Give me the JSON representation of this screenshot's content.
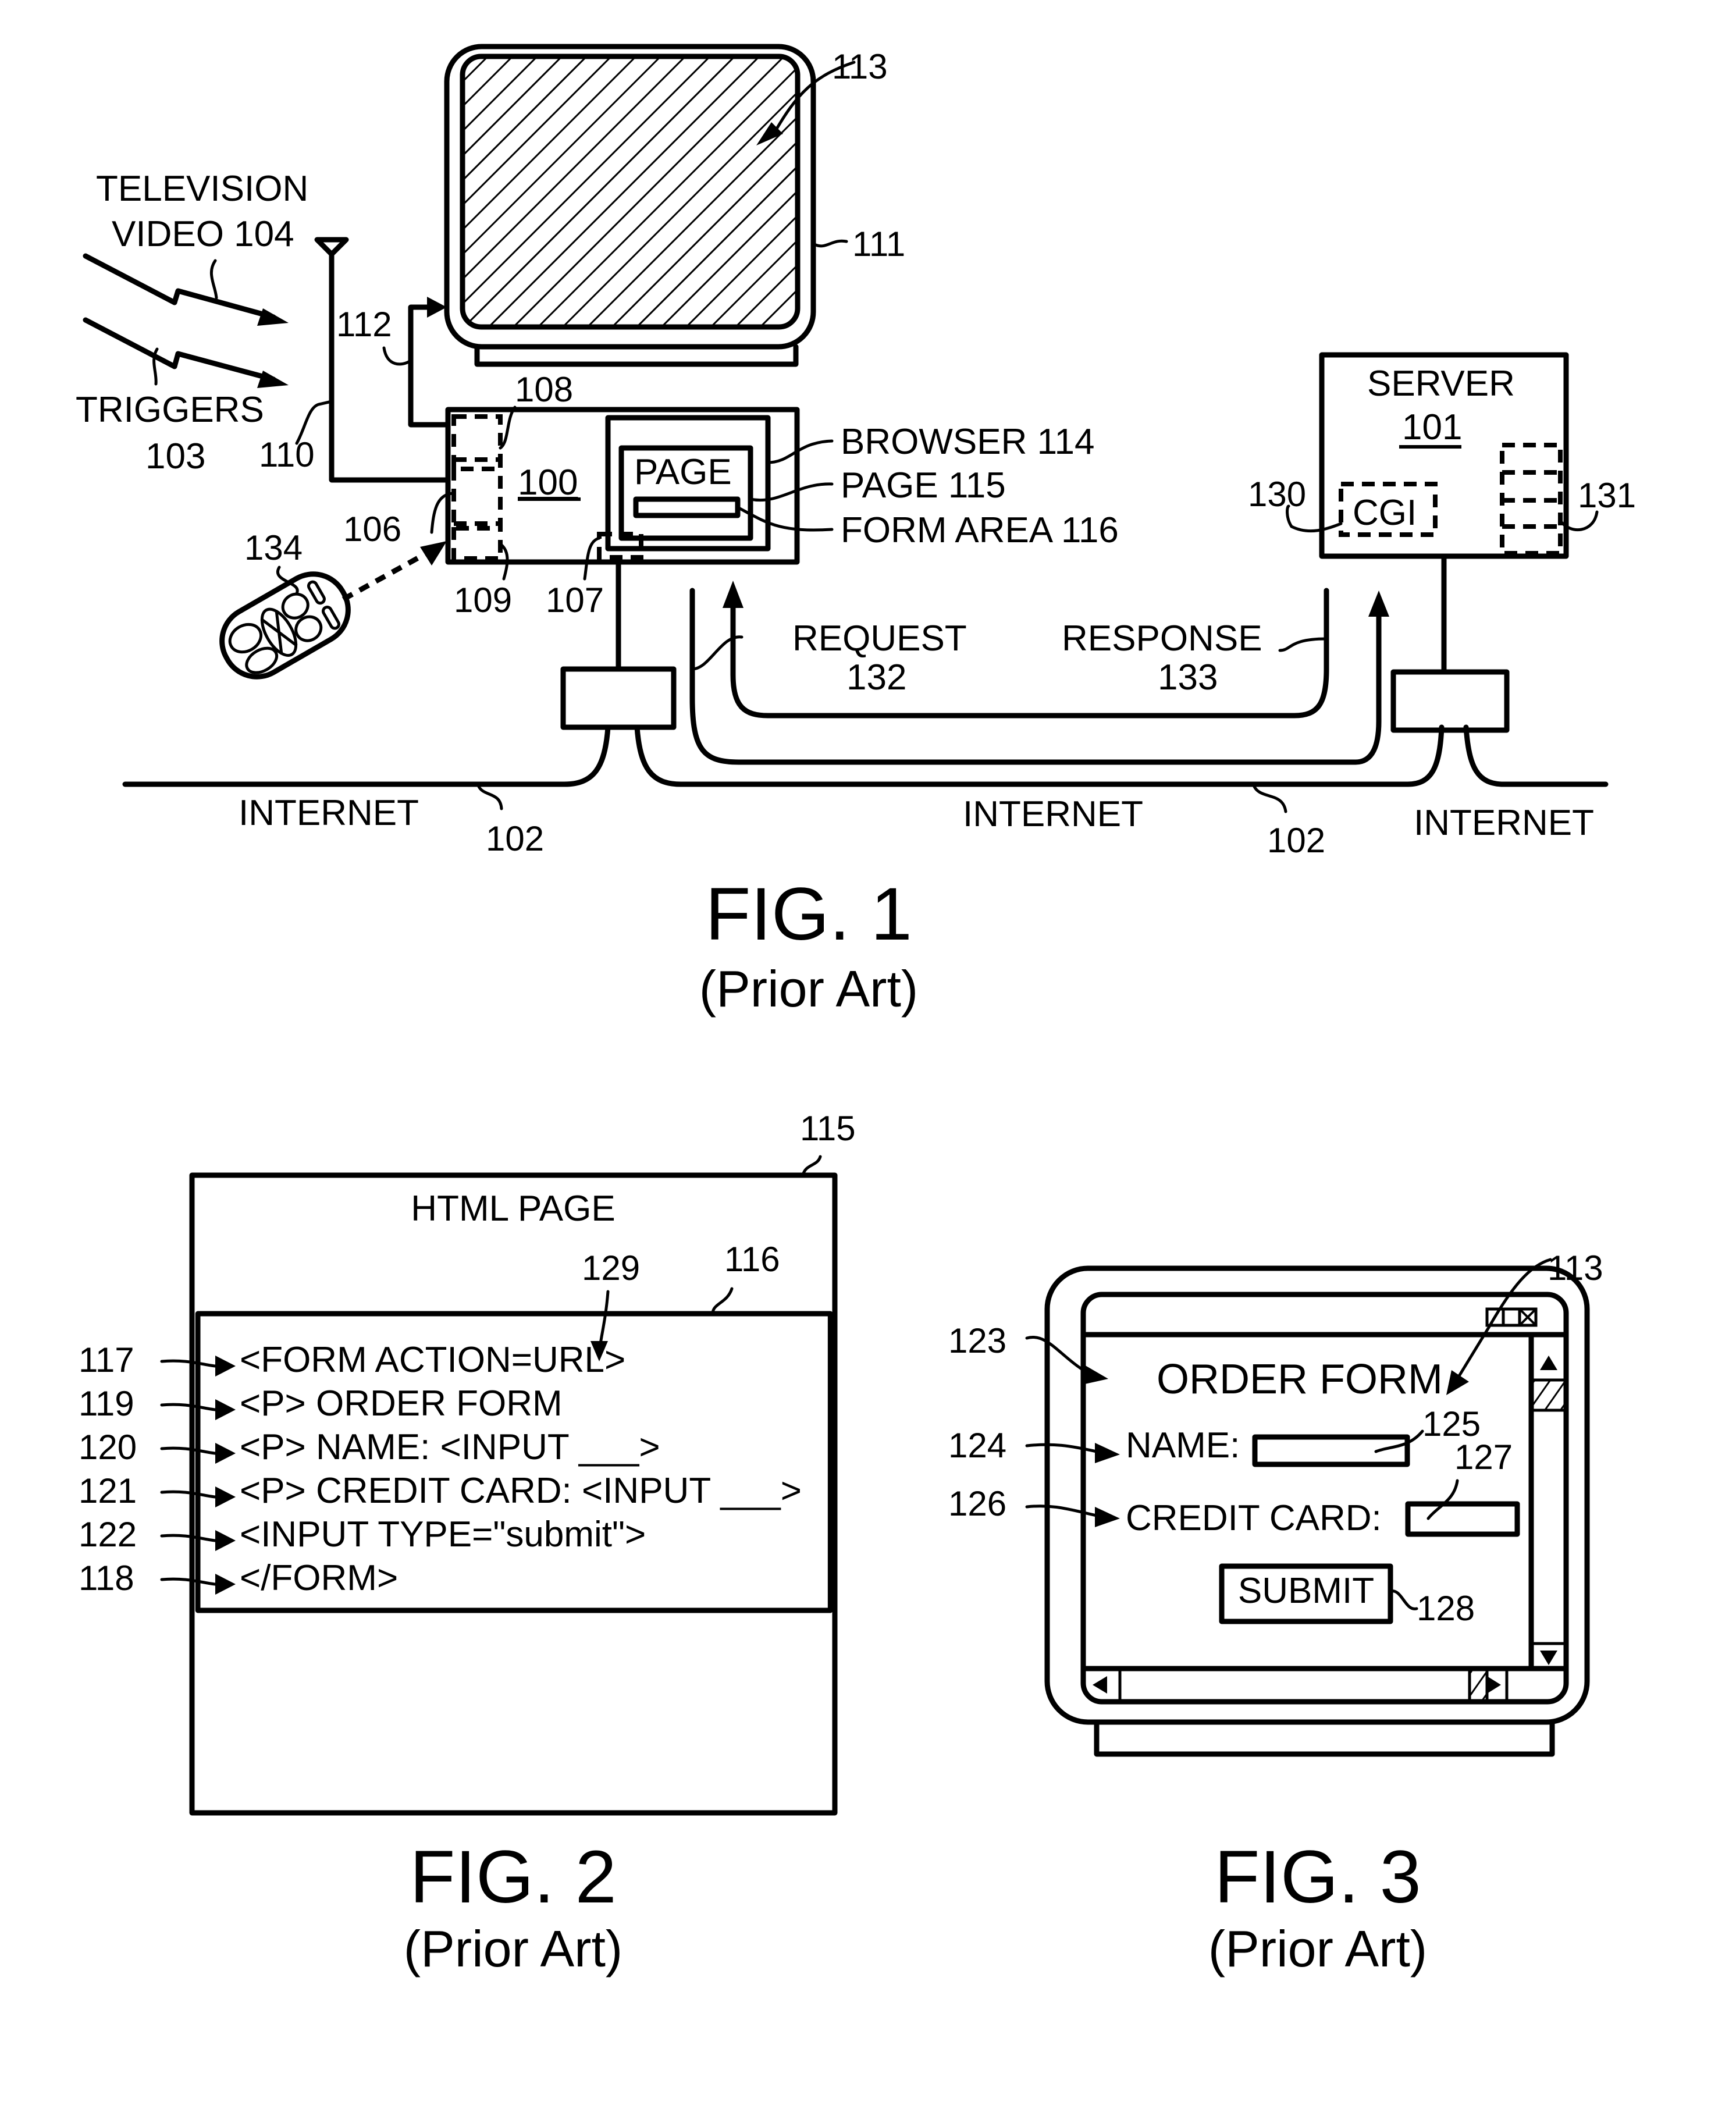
{
  "document": {
    "type": "patent drawing sheet",
    "colors": {
      "ink": "#000000",
      "paper": "#ffffff"
    }
  },
  "fig1": {
    "caption": "FIG. 1",
    "subcaption": "(Prior Art)",
    "labels": {
      "television_line1": "TELEVISION",
      "television_line2": "VIDEO 104",
      "triggers_line1": "TRIGGERS",
      "triggers_line2": "103",
      "antenna_ref": "110",
      "connection_ref": "112",
      "tv_ref": "111",
      "screen_ref": "113",
      "box_ref": "100",
      "module_108": "108",
      "module_106": "106",
      "module_109": "109",
      "module_107": "107",
      "remote_ref": "134",
      "page_box_text": "PAGE",
      "browser": "BROWSER 114",
      "page": "PAGE 115",
      "form_area": "FORM AREA 116",
      "server_title": "SERVER",
      "server_ref": "101",
      "cgi_text": "CGI",
      "cgi_ref": "130",
      "storage_ref": "131",
      "request_line1": "REQUEST",
      "request_line2": "132",
      "response_line1": "RESPONSE",
      "response_line2": "133",
      "internet_left": "INTERNET",
      "internet_mid": "INTERNET",
      "internet_right": "INTERNET",
      "internet_ref_left": "102",
      "internet_ref_mid": "102"
    }
  },
  "fig2": {
    "caption": "FIG. 2",
    "subcaption": "(Prior Art)",
    "page_ref": "115",
    "page_title": "HTML PAGE",
    "form_ref": "116",
    "url_ref": "129",
    "code_lines": [
      {
        "ref": "117",
        "text": "<FORM ACTION=URL>"
      },
      {
        "ref": "119",
        "text": "<P> ORDER FORM"
      },
      {
        "ref": "120",
        "text": "<P> NAME: <INPUT ___>"
      },
      {
        "ref": "121",
        "text": "<P> CREDIT CARD: <INPUT ___>"
      },
      {
        "ref": "122",
        "text": "<INPUT TYPE=\"submit\">"
      },
      {
        "ref": "118",
        "text": "</FORM>"
      }
    ]
  },
  "fig3": {
    "caption": "FIG. 3",
    "subcaption": "(Prior Art)",
    "screen_ref": "113",
    "title_ref": "123",
    "title": "ORDER FORM",
    "name_ref": "124",
    "name_label": "NAME:",
    "name_input_ref": "125",
    "card_ref": "126",
    "card_label": "CREDIT CARD:",
    "card_input_ref": "127",
    "submit_label": "SUBMIT",
    "submit_ref": "128",
    "window_controls": [
      "minimize-icon",
      "maximize-icon",
      "close-icon"
    ]
  }
}
